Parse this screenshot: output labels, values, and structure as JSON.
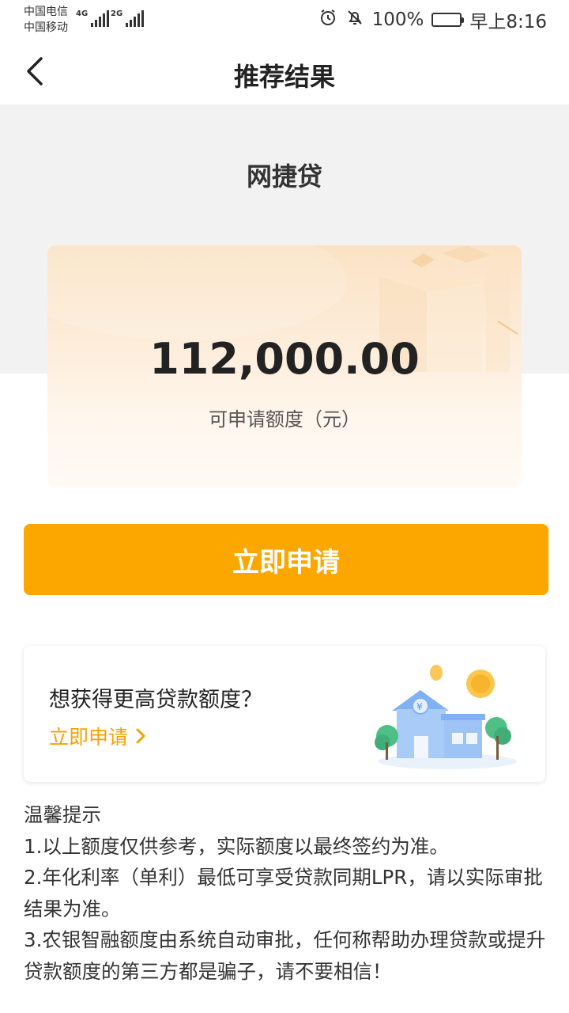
{
  "status_bar": {
    "carrier_1": "中国电信",
    "carrier_2": "中国移动",
    "network_1": "4G",
    "network_2": "2G",
    "battery": "100%",
    "time": "早上8:16"
  },
  "nav": {
    "title": "推荐结果"
  },
  "product": {
    "name": "网捷贷",
    "amount": "112,000.00",
    "amount_label": "可申请额度（元）"
  },
  "actions": {
    "apply_label": "立即申请"
  },
  "upgrade": {
    "question": "想获得更高贷款额度？",
    "link_label": "立即申请"
  },
  "tips": {
    "title": "温馨提示",
    "items": [
      "1.以上额度仅供参考，实际额度以最终签约为准。",
      "2.年化利率（单利）最低可享受贷款同期LPR，请以实际审批结果为准。",
      "3.农银智融额度由系统自动审批，任何称帮助办理贷款或提升贷款额度的第三方都是骗子，请不要相信！"
    ]
  },
  "icons": {
    "back": "chevron-left-icon",
    "alarm": "alarm-icon",
    "mute": "bell-off-icon",
    "battery": "battery-icon",
    "arrow": "chevron-right-icon"
  },
  "colors": {
    "accent": "#fba700",
    "link": "#f5a300",
    "header_bg": "#f2f2f2"
  }
}
